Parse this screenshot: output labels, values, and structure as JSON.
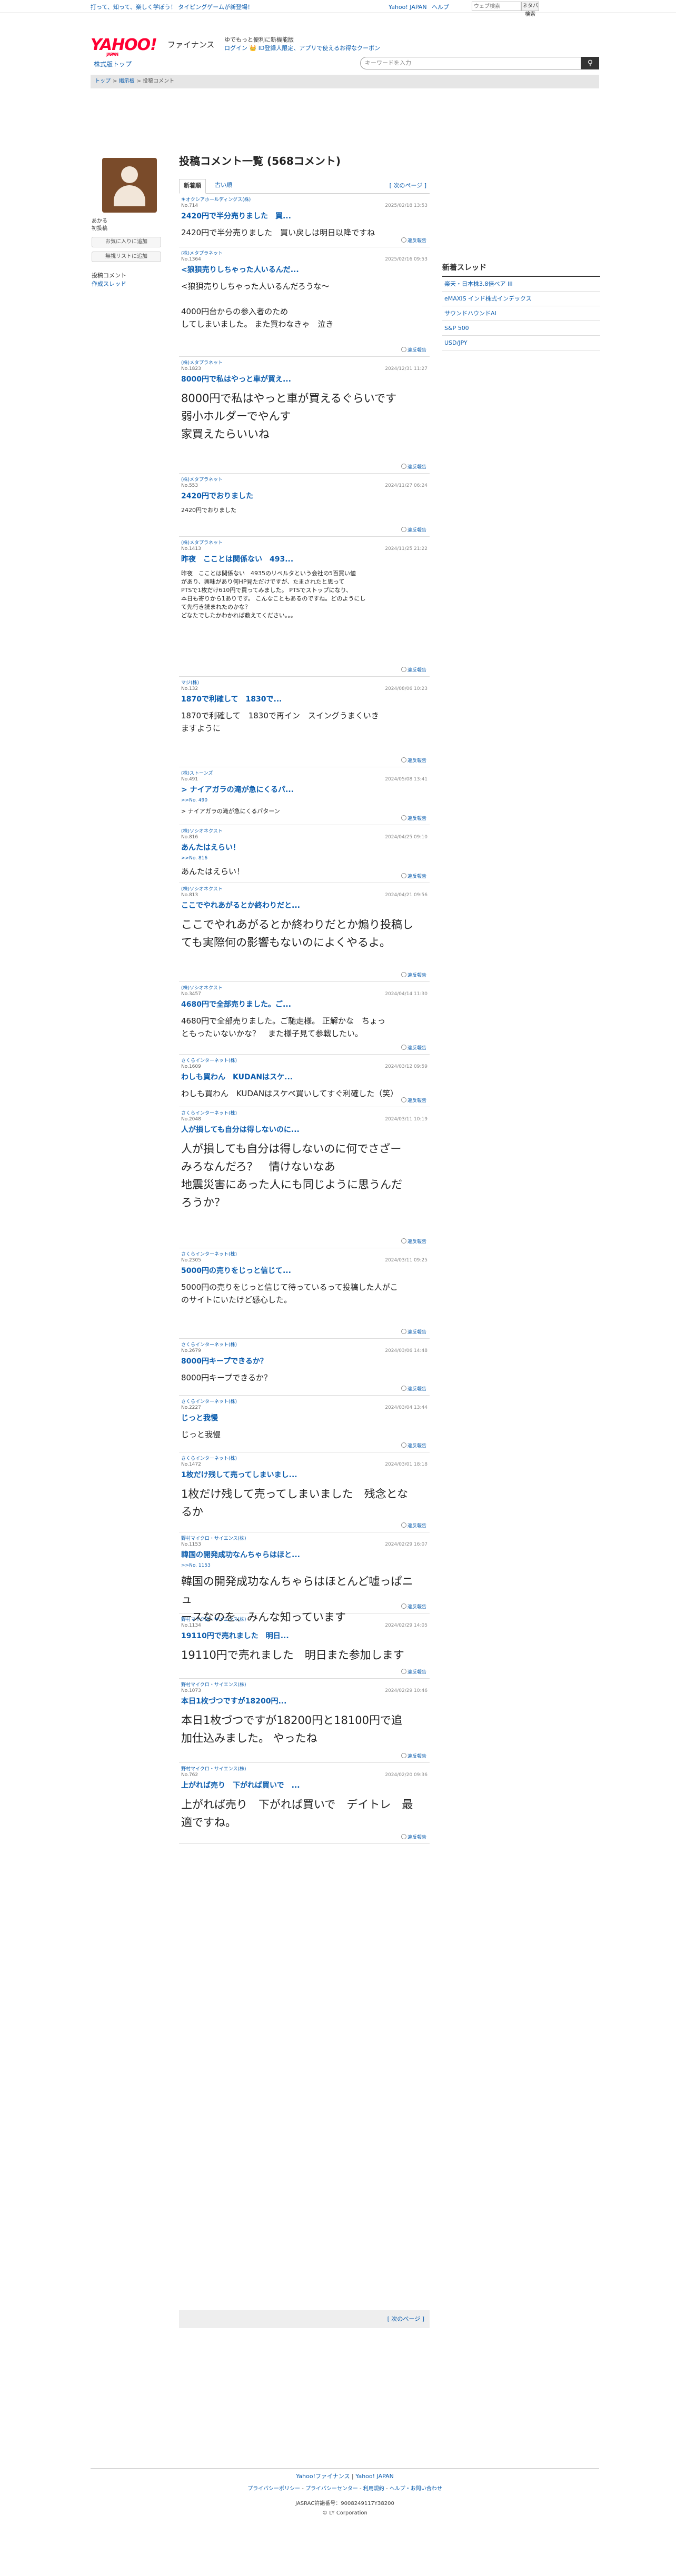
{
  "topbar": {
    "tagline": "打って、知って、楽しく学ぼう！ タイピングゲームが新登場！",
    "links": [
      "Yahoo! JAPAN",
      "ヘルプ"
    ],
    "search_placeholder": "ウェブ検索",
    "search_btn": "ネタバ検索"
  },
  "header": {
    "logo": "YAHOO!",
    "logo_sub": "JAPAN",
    "service": "ファイナンス",
    "promo1": "ゆでもっと便利に新機能版",
    "promo2": "ログイン 👑 ID登録人限定、アプリで使えるお得なクーポン"
  },
  "nav": {
    "finance_top": "株式版トップ",
    "search_placeholder": "キーワードを入力"
  },
  "breadcrumb": [
    "トップ",
    "掲示板",
    "投稿コメント"
  ],
  "sidebar": {
    "name_line1": "あかる",
    "name_line2": "初投稿",
    "btn_favorite": "お気に入りに追加",
    "btn_ignore": "無視リストに追加",
    "links": [
      "投稿コメント",
      "作成スレッド"
    ]
  },
  "main": {
    "title": "投稿コメント一覧 (568コメント)",
    "tab_active": "新着順",
    "tab_other": "古い順",
    "next": "[ 次のページ ]",
    "report_label": "違反報告",
    "posts": [
      {
        "author": "キオクシアホールディングス(株)",
        "no": "No.714",
        "date": "2025/02/18 13:53",
        "title": "2420円で半分売りました　買...",
        "body": "2420円で半分売りました　買い戻しは明日以降ですね",
        "size": "m"
      },
      {
        "author": "(株)メタプラネット",
        "no": "No.1364",
        "date": "2025/02/16 09:53",
        "title": "<狼狽売りしちゃった人いるんだ...",
        "body": "<狼狽売りしちゃった人いるんだろうな〜\n\n4000円台からの参入者のため\nしてしまいました。 また買わなきゃ　泣き",
        "size": "m"
      },
      {
        "author": "(株)メタプラネット",
        "no": "No.1823",
        "date": "2024/12/31 11:27",
        "title": "8000円で私はやっと車が買え...",
        "body": "8000円で私はやっと車が買えるぐらいです\n弱小ホルダーでやんす\n家買えたらいいね",
        "size": "l"
      },
      {
        "author": "(株)メタプラネット",
        "no": "No.553",
        "date": "2024/11/27 06:24",
        "title": "2420円でおりました",
        "body": "2420円でおりました",
        "size": "s"
      },
      {
        "author": "(株)メタプラネット",
        "no": "No.1413",
        "date": "2024/11/25 21:22",
        "title": "昨夜　こことは関係ない　493...",
        "body": "昨夜　こことは関係ない　4935のリベルタという会社の5百買い値\nがあり、興味があり何HP見ただけですが、たまされたと思って\nPTSで1枚だけ610円で買ってみました。 PTSでストップになり、\n本日も寄りから1ありです。 こんなこともあるのですね。どのようにし\nて先行き読まれたのかな？\nどなたでしたかわかれば教えてください。。。",
        "size": "s"
      },
      {
        "author": "マジ(株)",
        "no": "No.132",
        "date": "2024/08/06 10:23",
        "title": "1870で利確して　1830で...",
        "body": "1870で利確して　1830で再イン　スイングうまくいき\nますように",
        "size": "m"
      },
      {
        "author": "(株)ストーンズ",
        "no": "No.491",
        "date": "2024/05/08 13:41",
        "title": "> ナイアガラの滝が急にくるパ...",
        "reply": ">>No. 490",
        "body": "> ナイアガラの滝が急にくるパターン",
        "size": "s"
      },
      {
        "author": "(株)ソシオネクスト",
        "no": "No.816",
        "date": "2024/04/25 09:10",
        "title": "あんたはえらい！",
        "reply": ">>No. 816",
        "body": "あんたはえらい！",
        "size": "m"
      },
      {
        "author": "(株)ソシオネクスト",
        "no": "No.813",
        "date": "2024/04/21 09:56",
        "title": "ここでやれあがるとか終わりだと...",
        "body": "ここでやれあがるとか終わりだとか煽り投稿し\nても実際何の影響もないのによくやるよ。",
        "size": "l"
      },
      {
        "author": "(株)ソシオネクスト",
        "no": "No.3457",
        "date": "2024/04/14 11:30",
        "title": "4680円で全部売りました。ご...",
        "body": "4680円で全部売りました。ご馳走様。 正解かな　ちょっ\nともったいないかな？　また様子見て参戦したい。",
        "size": "m"
      },
      {
        "author": "さくらインターネット(株)",
        "no": "No.1609",
        "date": "2024/03/12 09:59",
        "title": "わしも買わん　KUDANはスケ...",
        "body": "わしも買わん　KUDANはスケベ買いしてすぐ利確した（笑）",
        "size": "m"
      },
      {
        "author": "さくらインターネット(株)",
        "no": "No.2048",
        "date": "2024/03/11 10:19",
        "title": "人が損しても自分は得しないのに...",
        "body": "人が損しても自分は得しないのに何でさざー\nみろなんだろ？　情けないなあ\n地震災害にあった人にも同じように思うんだ\nろうか？",
        "size": "l"
      },
      {
        "author": "さくらインターネット(株)",
        "no": "No.2305",
        "date": "2024/03/11 09:25",
        "title": "5000円の売りをじっと信じて...",
        "body": "5000円の売りをじっと信じて待っているって投稿した人がこ\nのサイトにいたけど感心した。",
        "size": "m"
      },
      {
        "author": "さくらインターネット(株)",
        "no": "No.2679",
        "date": "2024/03/06 14:48",
        "title": "8000円キープできるか？",
        "body": "8000円キープできるか？",
        "size": "m"
      },
      {
        "author": "さくらインターネット(株)",
        "no": "No.2227",
        "date": "2024/03/04 13:44",
        "title": "じっと我慢",
        "body": "じっと我慢",
        "size": "m"
      },
      {
        "author": "さくらインターネット(株)",
        "no": "No.1472",
        "date": "2024/03/01 18:18",
        "title": "1枚だけ残して売ってしまいまし...",
        "body": "1枚だけ残して売ってしまいました　残念とな\nるか",
        "size": "l"
      },
      {
        "author": "野村マイクロ・サイエンス(株)",
        "no": "No.1153",
        "date": "2024/02/29 16:07",
        "title": "韓国の開発成功なんちゃらはほと...",
        "reply": ">>No. 1153",
        "body": "韓国の開発成功なんちゃらはほとんど嘘っぱニュ\nースなのを、みんな知っています",
        "size": "l"
      },
      {
        "author": "野村マイクロ・サイエンス(株)",
        "no": "No.1134",
        "date": "2024/02/29 14:05",
        "title": "19110円で売れました　明日...",
        "body": "19110円で売れました　明日また参加します",
        "size": "l"
      },
      {
        "author": "野村マイクロ・サイエンス(株)",
        "no": "No.1073",
        "date": "2024/02/29 10:46",
        "title": "本日1枚づつですが18200円...",
        "body": "本日1枚づつですが18200円と18100円で追\n加仕込みました。 やったね",
        "size": "l"
      },
      {
        "author": "野村マイクロ・サイエンス(株)",
        "no": "No.762",
        "date": "2024/02/20 09:36",
        "title": "上がれば売り　下がれば買いで　...",
        "body": "上がれば売り　下がれば買いで　デイトレ　最\n適ですね。",
        "size": "l"
      }
    ]
  },
  "right": {
    "title": "新着スレッド",
    "items": [
      "楽天・日本株3.8倍ベア III",
      "eMAXIS インド株式インデックス",
      "サウンドハウンドAI",
      "S&P 500",
      "USD/JPY"
    ]
  },
  "footer": {
    "links1": [
      "Yahoo!ファイナンス",
      "Yahoo! JAPAN"
    ],
    "links2": [
      "プライバシーポリシー",
      "プライバシーセンター",
      "利用規約",
      "ヘルプ・お問い合わせ"
    ],
    "license": "JASRAC許諾番号：9008249117Y38200",
    "copyright": "© LY Corporation"
  }
}
